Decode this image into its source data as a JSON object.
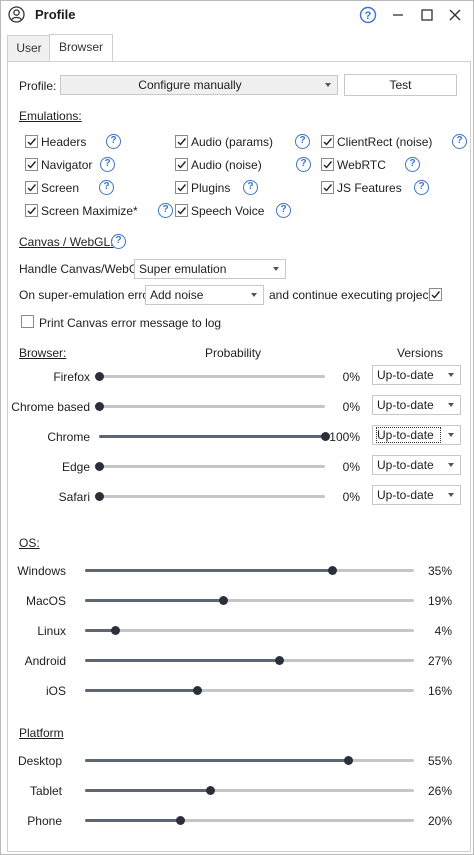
{
  "window": {
    "title": "Profile"
  },
  "tabs": [
    {
      "label": "User",
      "active": false
    },
    {
      "label": "Browser",
      "active": true
    }
  ],
  "profile": {
    "label": "Profile:",
    "value": "Configure manually",
    "test_button": "Test"
  },
  "emulations": {
    "label": "Emulations:",
    "items": [
      {
        "label": "Headers",
        "checked": true
      },
      {
        "label": "Audio (params)",
        "checked": true
      },
      {
        "label": "ClientRect (noise)",
        "checked": true
      },
      {
        "label": "Navigator",
        "checked": true
      },
      {
        "label": "Audio (noise)",
        "checked": true
      },
      {
        "label": "WebRTC",
        "checked": true
      },
      {
        "label": "Screen",
        "checked": true
      },
      {
        "label": "Plugins",
        "checked": true
      },
      {
        "label": "JS Features",
        "checked": true
      },
      {
        "label": "Screen Maximize*",
        "checked": true
      },
      {
        "label": "Speech Voice",
        "checked": true
      }
    ]
  },
  "canvas": {
    "label": "Canvas / WebGL:",
    "handle_label": "Handle Canvas/WebGL",
    "handle_value": "Super emulation",
    "error_label": "On super-emulation error",
    "error_value": "Add noise",
    "continue_label": "and continue executing project",
    "continue_checked": true,
    "print_label": "Print Canvas error message to log",
    "print_checked": false
  },
  "browser": {
    "label": "Browser:",
    "prob_header": "Probability",
    "versions_header": "Versions",
    "rows": [
      {
        "name": "Firefox",
        "value": 0,
        "pct": "0%",
        "version": "Up-to-date"
      },
      {
        "name": "Chrome based",
        "value": 0,
        "pct": "0%",
        "version": "Up-to-date"
      },
      {
        "name": "Chrome",
        "value": 100,
        "pct": "100%",
        "version": "Up-to-date"
      },
      {
        "name": "Edge",
        "value": 0,
        "pct": "0%",
        "version": "Up-to-date"
      },
      {
        "name": "Safari",
        "value": 0,
        "pct": "0%",
        "version": "Up-to-date"
      }
    ]
  },
  "os": {
    "label": "OS:",
    "rows": [
      {
        "name": "Windows",
        "value": 75,
        "pct": "35%"
      },
      {
        "name": "MacOS",
        "value": 42,
        "pct": "19%"
      },
      {
        "name": "Linux",
        "value": 9,
        "pct": "4%"
      },
      {
        "name": "Android",
        "value": 59,
        "pct": "27%"
      },
      {
        "name": "iOS",
        "value": 34,
        "pct": "16%"
      }
    ]
  },
  "platform": {
    "label": "Platform",
    "rows": [
      {
        "name": "Desktop",
        "value": 80,
        "pct": "55%"
      },
      {
        "name": "Tablet",
        "value": 38,
        "pct": "26%"
      },
      {
        "name": "Phone",
        "value": 29,
        "pct": "20%"
      }
    ]
  },
  "colors": {
    "help": "#3b73c6",
    "slider_fill": "#5d6675",
    "slider_thumb": "#2a2f39",
    "track": "#c6c6c6"
  },
  "icons": {
    "title": "profile-icon",
    "help": "help-icon",
    "minimize": "minimize-icon",
    "maximize": "maximize-icon",
    "close": "close-icon"
  }
}
